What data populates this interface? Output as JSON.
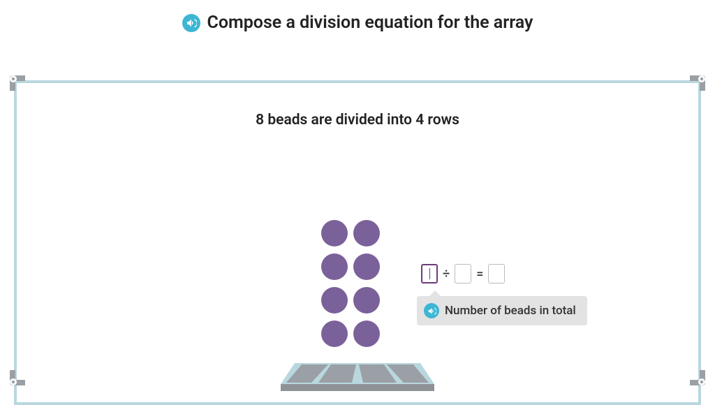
{
  "title": "Compose a division equation for the array",
  "subtitle": "8 beads are divided into 4 rows",
  "array": {
    "rows": 4,
    "cols": 2,
    "bead_color": "#7b6199"
  },
  "equation": {
    "op": "÷",
    "eq": "=",
    "dividend": "",
    "divisor": "",
    "quotient": ""
  },
  "hint": "Number of beads in total",
  "colors": {
    "accent": "#3db6d4",
    "frame": "#b9d7df",
    "corner": "#9aa0a5"
  }
}
